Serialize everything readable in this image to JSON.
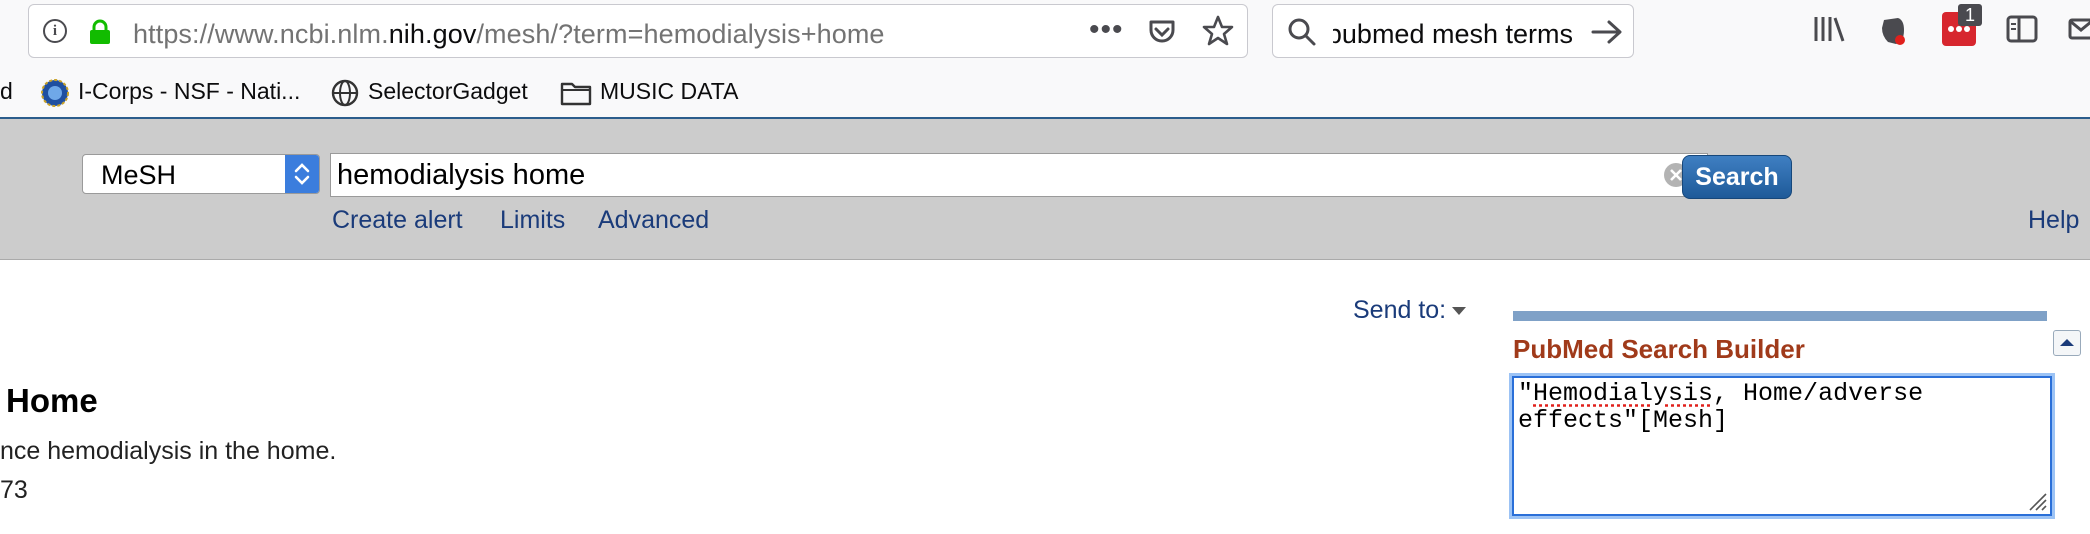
{
  "browser": {
    "url": {
      "prefix": "https://www.ncbi.nlm.",
      "domain": "nih.gov",
      "path": "/mesh/?term=hemodialysis+home"
    },
    "search_text": "pubmed mesh terms",
    "notification_count": "1",
    "bookmarks": [
      {
        "label": "d"
      },
      {
        "label": "I-Corps - NSF - Nati..."
      },
      {
        "label": "SelectorGadget"
      },
      {
        "label": "MUSIC DATA"
      }
    ]
  },
  "ncbi": {
    "database": "MeSH",
    "term": "hemodialysis home",
    "search_label": "Search",
    "links": {
      "create_alert": "Create alert",
      "limits": "Limits",
      "advanced": "Advanced"
    },
    "help": "Help"
  },
  "content": {
    "send_to": "Send to:",
    "heading": "Home",
    "scope_note": "nce hemodialysis in the home.",
    "year": "73"
  },
  "builder": {
    "title": "PubMed Search Builder",
    "text_pre": "\"",
    "text_misspelled": "Hemodialysis",
    "text_post": ", Home/adverse effects\"[Mesh]"
  },
  "colors": {
    "link": "#1a3b7a",
    "builder_title": "#a03a1a",
    "search_button": "#1e5a99",
    "ncbi_bar": "#cccccc"
  }
}
